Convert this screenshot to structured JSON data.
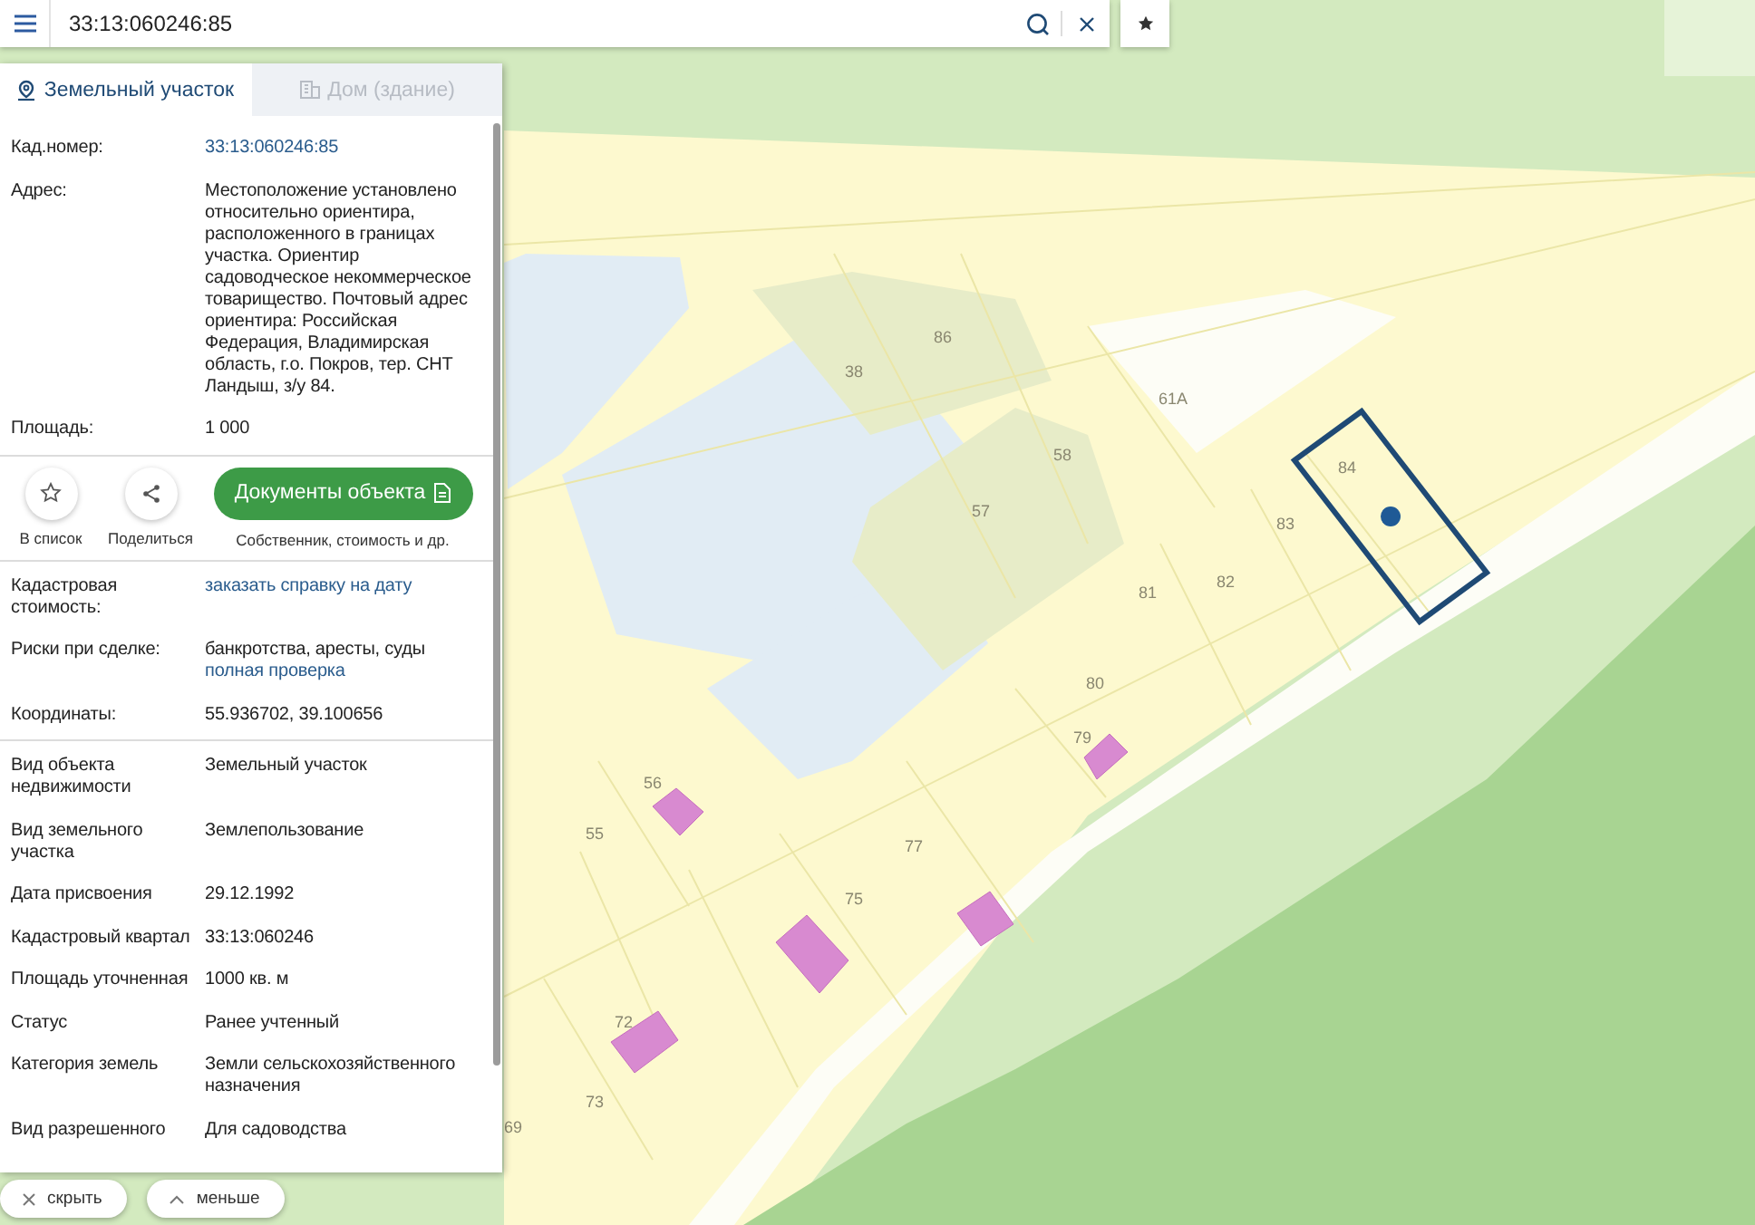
{
  "search": {
    "value": "33:13:060246:85"
  },
  "tabs": [
    {
      "label": "Земельный участок",
      "selected": true
    },
    {
      "label": "Дом (здание)",
      "selected": false
    }
  ],
  "details_top": [
    {
      "label": "Кад.номер:",
      "value": "33:13:060246:85",
      "kind": "link"
    },
    {
      "label": "Адрес:",
      "value": "Местоположение установлено относительно ориентира, расположенного в границах участка. Ориентир садоводческое некоммерческое товарищество. Почтовый адрес ориентира: Российская Федерация, Владимирская область, г.о. Покров, тер. СНТ Ландыш, з/у 84.",
      "kind": "text"
    },
    {
      "label": "Площадь:",
      "value": "1 000",
      "kind": "text"
    }
  ],
  "actions": [
    {
      "label": "В список"
    },
    {
      "label": "Поделиться"
    }
  ],
  "documents_button": {
    "label": "Документы объекта",
    "caption": "Собственник, стоимость и др."
  },
  "details_mid": [
    {
      "label": "Кадастровая стоимость:",
      "value": "заказать справку на дату",
      "kind": "link"
    },
    {
      "label": "Риски при сделке:",
      "value": "банкротства, аресты, суды",
      "link": "полная проверка",
      "kind": "text"
    },
    {
      "label": "Координаты:",
      "value": "55.936702, 39.100656",
      "kind": "text"
    }
  ],
  "details_bottom": [
    {
      "label": "Вид объекта недвижимости",
      "value": "Земельный участок",
      "kind": "text"
    },
    {
      "label": "Вид земельного участка",
      "value": "Землепользование",
      "kind": "text"
    },
    {
      "label": "Дата присвоения",
      "value": "29.12.1992",
      "kind": "text"
    },
    {
      "label": "Кадастровый квартал",
      "value": "33:13:060246",
      "kind": "text"
    },
    {
      "label": "Площадь уточненная",
      "value": "1000 кв. м",
      "kind": "text"
    },
    {
      "label": "Статус",
      "value": "Ранее учтенный",
      "kind": "text"
    },
    {
      "label": "Категория земель",
      "value": "Земли сельскохозяйственного назначения",
      "kind": "text"
    },
    {
      "label": "Вид разрешенного",
      "value": "Для садоводства",
      "kind": "text"
    }
  ],
  "footer_buttons": [
    {
      "label": "скрыть"
    },
    {
      "label": "меньше"
    }
  ],
  "map": {
    "parcel_labels": [
      "86",
      "38",
      "61А",
      "58",
      "57",
      "84",
      "83",
      "82",
      "81",
      "80",
      "79",
      "56",
      "55",
      "77",
      "75",
      "72",
      "73",
      "69"
    ]
  }
}
